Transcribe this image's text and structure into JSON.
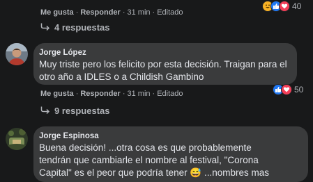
{
  "comments": [
    {
      "actions": {
        "like": "Me gusta",
        "reply": "Responder",
        "time": "31 min",
        "edited": "Editado"
      },
      "reaction_count": "40",
      "reaction_icons": [
        "haha-icon",
        "like-icon",
        "love-icon"
      ],
      "replies_label": "4 respuestas"
    },
    {
      "author": "Jorge López",
      "text": "Muy triste pero los felicito por esta decisión. Traigan para el otro año a IDLES o a Childish Gambino",
      "actions": {
        "like": "Me gusta",
        "reply": "Responder",
        "time": "31 min",
        "edited": "Editado"
      },
      "reaction_count": "50",
      "reaction_icons": [
        "like-icon",
        "love-icon"
      ],
      "replies_label": "9 respuestas"
    },
    {
      "author": "Jorge Espinosa",
      "text_lines": [
        "Buena decisión! ...otra cosa es que probablemente",
        "tendrán que cambiarle el nombre al festival, \"Corona",
        "Capital\" es el peor que podría tener 😅 ...nombres mas"
      ]
    }
  ],
  "colors": {
    "background": "#18191a",
    "bubble": "#3a3b3c",
    "like_blue": "#2078f4",
    "love_red": "#f33e58",
    "haha_yellow": "#f7b125"
  }
}
